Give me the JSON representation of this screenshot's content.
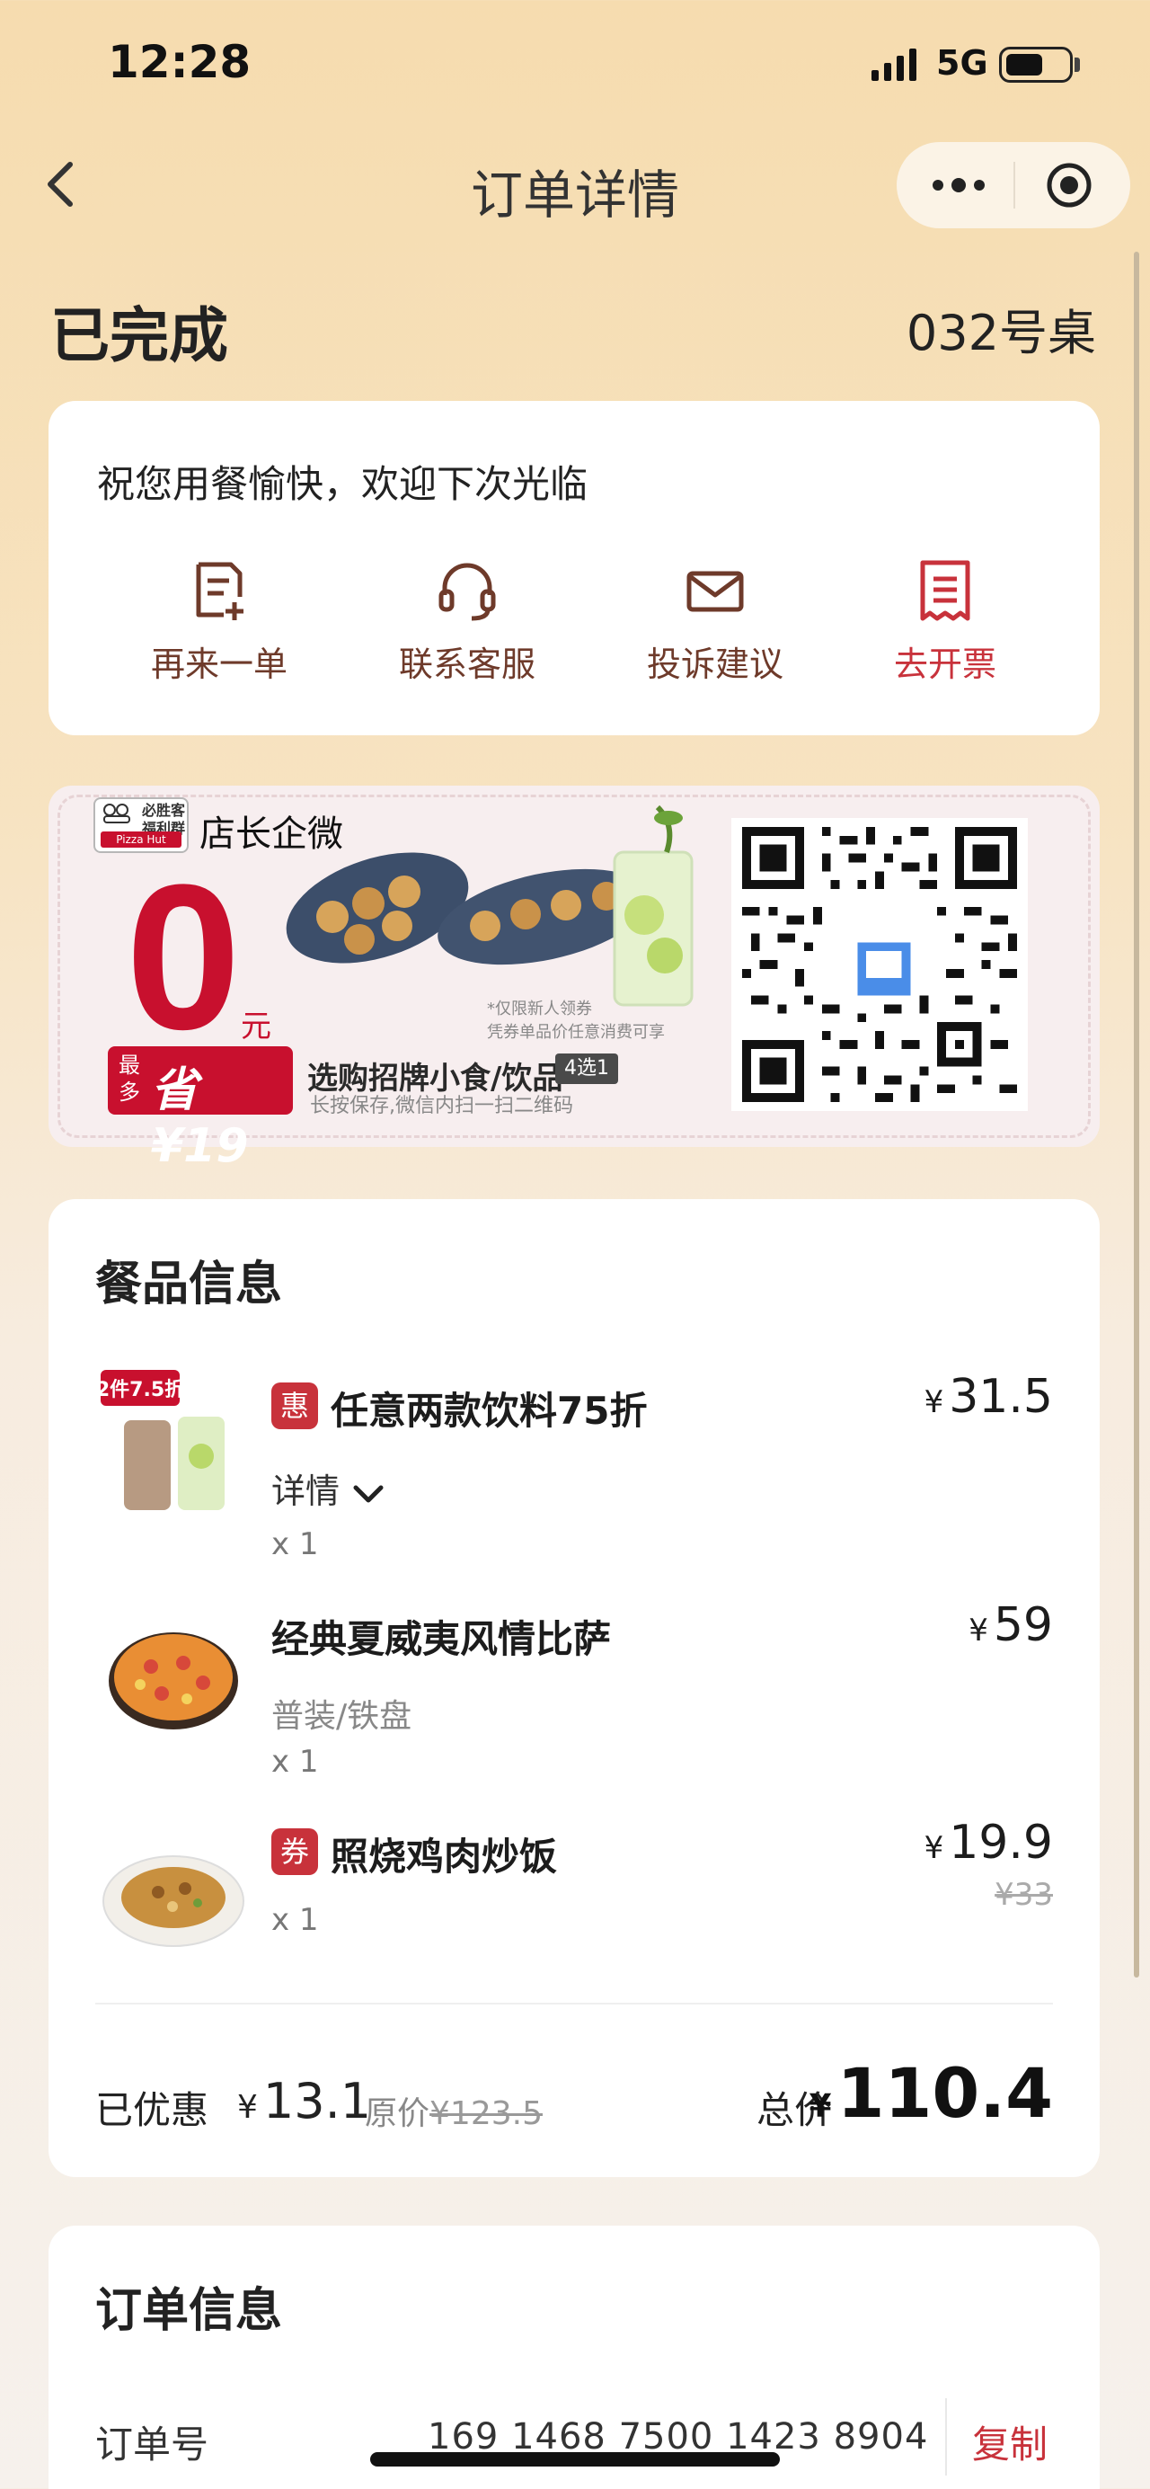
{
  "status_bar": {
    "time": "12:28",
    "network": "5G"
  },
  "nav": {
    "title": "订单详情"
  },
  "order": {
    "status": "已完成",
    "table": "032号桌"
  },
  "greeting": {
    "text": "祝您用餐愉快，欢迎下次光临",
    "actions": [
      {
        "label": "再来一单",
        "icon": "reorder-icon"
      },
      {
        "label": "联系客服",
        "icon": "headset-icon"
      },
      {
        "label": "投诉建议",
        "icon": "mail-icon"
      },
      {
        "label": "去开票",
        "icon": "invoice-icon"
      }
    ]
  },
  "promo": {
    "brand_line1": "必胜客福利群",
    "brand_red": "Pizza Hut",
    "caption": "店长企微",
    "big_number": "0",
    "unit": "元",
    "save_small": "最多",
    "save_big": "省¥19",
    "title": "选购招牌小食/饮品",
    "tag": "4选1",
    "small": "长按保存,微信内扫一扫二维码",
    "note_line1": "*仅限新人领券",
    "note_line2": "凭券单品价任意消费可享"
  },
  "food": {
    "title": "餐品信息",
    "items": [
      {
        "tag": "惠",
        "name": "任意两款饮料75折",
        "detail": "详情",
        "qty": "x 1",
        "currency": "¥",
        "price": "31.5",
        "thumb_label": "2件7.5折"
      },
      {
        "name": "经典夏威夷风情比萨",
        "sub": "普装/铁盘",
        "qty": "x 1",
        "currency": "¥",
        "price": "59"
      },
      {
        "tag": "券",
        "name": "照烧鸡肉炒饭",
        "qty": "x 1",
        "currency": "¥",
        "price": "19.9",
        "old_price": "¥33"
      }
    ],
    "summary": {
      "discount_label": "已优惠",
      "currency": "¥",
      "discount_value": "13.1",
      "orig_label": "原价",
      "orig_value": "¥123.5",
      "total_label": "总价",
      "total_value": "110.4"
    }
  },
  "order_info": {
    "title": "订单信息",
    "order_no_label": "订单号",
    "order_no": "169 1468 7500 1423 8904",
    "copy_label": "复制"
  },
  "colors": {
    "accent_red": "#c8323b",
    "brand_red": "#c8102e",
    "action_brown": "#6e3a2a"
  }
}
